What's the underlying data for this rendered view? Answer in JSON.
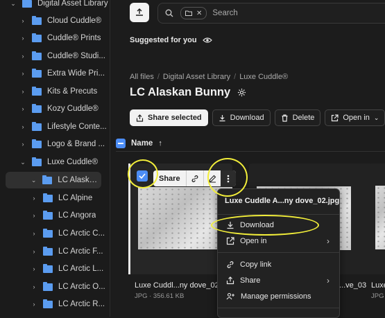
{
  "sidebar": {
    "items": [
      {
        "label": "Digital Asset Library"
      },
      {
        "label": "Cloud Cuddle®"
      },
      {
        "label": "Cuddle® Prints"
      },
      {
        "label": "Cuddle® Studi..."
      },
      {
        "label": "Extra Wide Pri..."
      },
      {
        "label": "Kits & Precuts"
      },
      {
        "label": "Kozy Cuddle®"
      },
      {
        "label": "Lifestyle Conte..."
      },
      {
        "label": "Logo & Brand ..."
      },
      {
        "label": "Luxe Cuddle®"
      },
      {
        "label": "LC Alaskan..."
      },
      {
        "label": "LC Alpine"
      },
      {
        "label": "LC Angora"
      },
      {
        "label": "LC Arctic C..."
      },
      {
        "label": "LC Arctic F..."
      },
      {
        "label": "LC Arctic L..."
      },
      {
        "label": "LC Arctic O..."
      },
      {
        "label": "LC Arctic R..."
      }
    ]
  },
  "search": {
    "placeholder": "Search"
  },
  "suggested": {
    "label": "Suggested for you"
  },
  "breadcrumb": {
    "all_files": "All files",
    "library": "Digital Asset Library",
    "luxe": "Luxe Cuddle®"
  },
  "page": {
    "title": "LC Alaskan Bunny"
  },
  "toolbar": {
    "share_selected": "Share selected",
    "download": "Download",
    "delete": "Delete",
    "open_in": "Open in"
  },
  "list_header": {
    "name": "Name",
    "sort": "↑"
  },
  "files": [
    {
      "name": "Luxe Cuddl...ny dove_02",
      "meta": "JPG · 356.61 KB"
    },
    {
      "name": "...ve_03",
      "meta": ""
    },
    {
      "name": "Luxe",
      "meta": "JPG ·"
    }
  ],
  "card_toolbar": {
    "share": "Share"
  },
  "context_menu": {
    "title": "Luxe Cuddle A...ny dove_02.jpg",
    "download": "Download",
    "open_in": "Open in",
    "copy_link": "Copy link",
    "share": "Share",
    "manage_permissions": "Manage permissions"
  },
  "colors": {
    "accent": "#4c8df6",
    "folder": "#5b9cf0",
    "highlight": "#f2ee3a",
    "bg": "#1c1c1c"
  }
}
